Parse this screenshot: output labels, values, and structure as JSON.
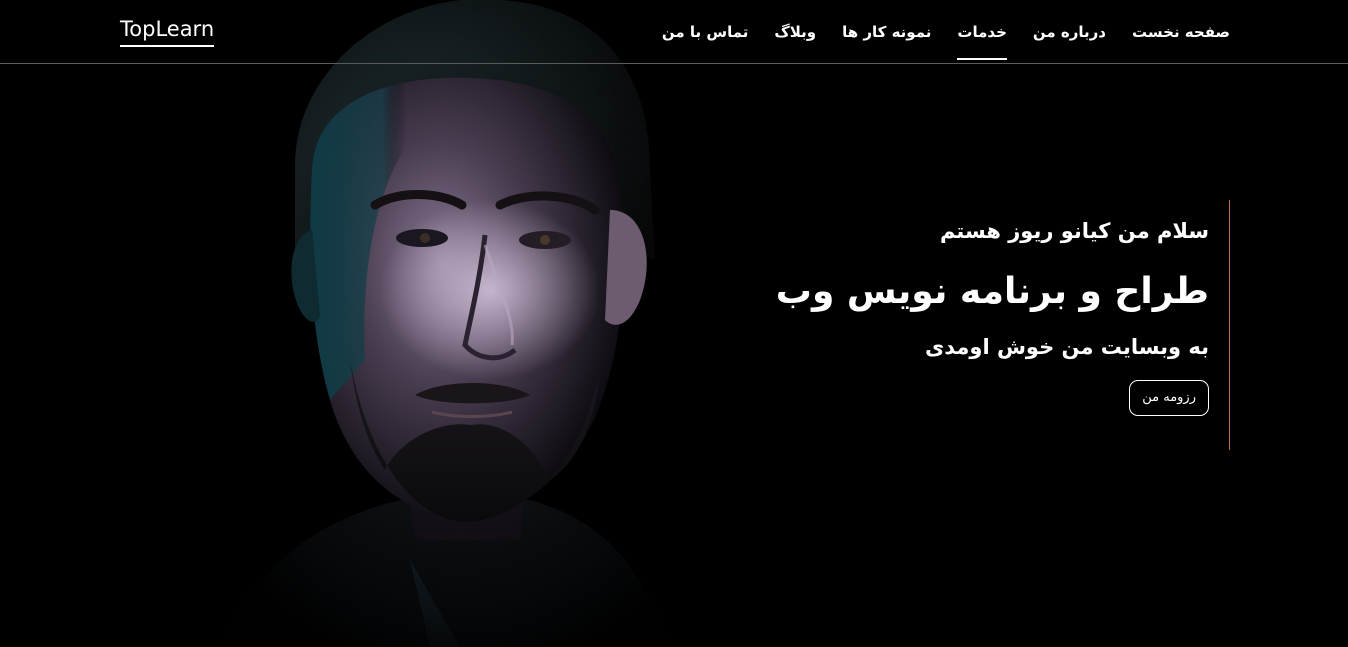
{
  "header": {
    "logo": "TopLearn",
    "nav": [
      {
        "label": "صفحه نخست",
        "active": false
      },
      {
        "label": "درباره من",
        "active": false
      },
      {
        "label": "خدمات",
        "active": true
      },
      {
        "label": "نمونه کار ها",
        "active": false
      },
      {
        "label": "وبلاگ",
        "active": false
      },
      {
        "label": "تماس با من",
        "active": false
      }
    ]
  },
  "hero": {
    "greeting": "سلام من کیانو ریوز هستم",
    "headline": "طراح و برنامه نویس وب",
    "welcome": "به وبسایت من خوش اومدی",
    "resume_button": "رزومه من"
  },
  "colors": {
    "background": "#000000",
    "text": "#ffffff",
    "accent_line": "#c2714f"
  }
}
